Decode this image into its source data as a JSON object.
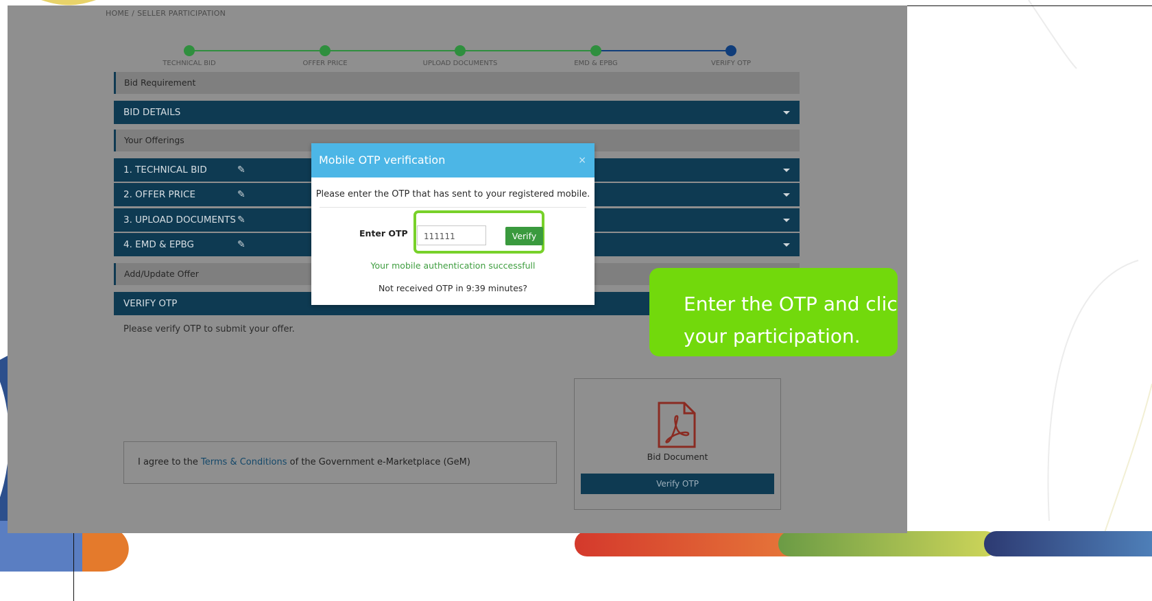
{
  "breadcrumb": {
    "home": "HOME",
    "separator": "/",
    "current": "SELLER PARTICIPATION"
  },
  "stepper": {
    "steps": [
      {
        "label": "TECHNICAL BID",
        "state": "complete"
      },
      {
        "label": "OFFER PRICE",
        "state": "complete"
      },
      {
        "label": "UPLOAD DOCUMENTS",
        "state": "complete"
      },
      {
        "label": "EMD & EPBG",
        "state": "complete"
      },
      {
        "label": "VERIFY OTP",
        "state": "active"
      }
    ],
    "complete_color": "#2f8f3e",
    "active_color": "#103d7a"
  },
  "sections": {
    "bid_requirement": "Bid Requirement",
    "bid_details": "BID DETAILS",
    "your_offerings": "Your Offerings",
    "offerings": [
      "1. TECHNICAL BID",
      "2. OFFER PRICE",
      "3. UPLOAD DOCUMENTS",
      "4. EMD & EPBG"
    ],
    "add_update_offer": "Add/Update Offer",
    "verify_otp": "VERIFY OTP",
    "note": "Please verify OTP to submit your offer."
  },
  "terms": {
    "prefix": "I agree to the",
    "link": "Terms & Conditions",
    "suffix": "of the Government e-Marketplace (GeM)"
  },
  "document": {
    "label": "Bid Document",
    "button": "Verify OTP",
    "icon": "pdf-icon"
  },
  "modal": {
    "title": "Mobile OTP verification",
    "close_symbol": "×",
    "instruction": "Please enter the OTP that has sent to your registered mobile.",
    "otp_label": "Enter OTP",
    "otp_value": "111111",
    "verify_button": "Verify",
    "success_message": "Your mobile authentication successfull",
    "resend_message": "Not received OTP in 9:39 minutes?"
  },
  "callout": {
    "line1": "Enter the OTP and click o",
    "line2": "your participation.",
    "color": "#72d90c"
  },
  "colors": {
    "accordion": "#0e3a52",
    "modal_header": "#4cb6e6",
    "highlight": "#78d12a",
    "verify_button": "#3a9a3e"
  }
}
